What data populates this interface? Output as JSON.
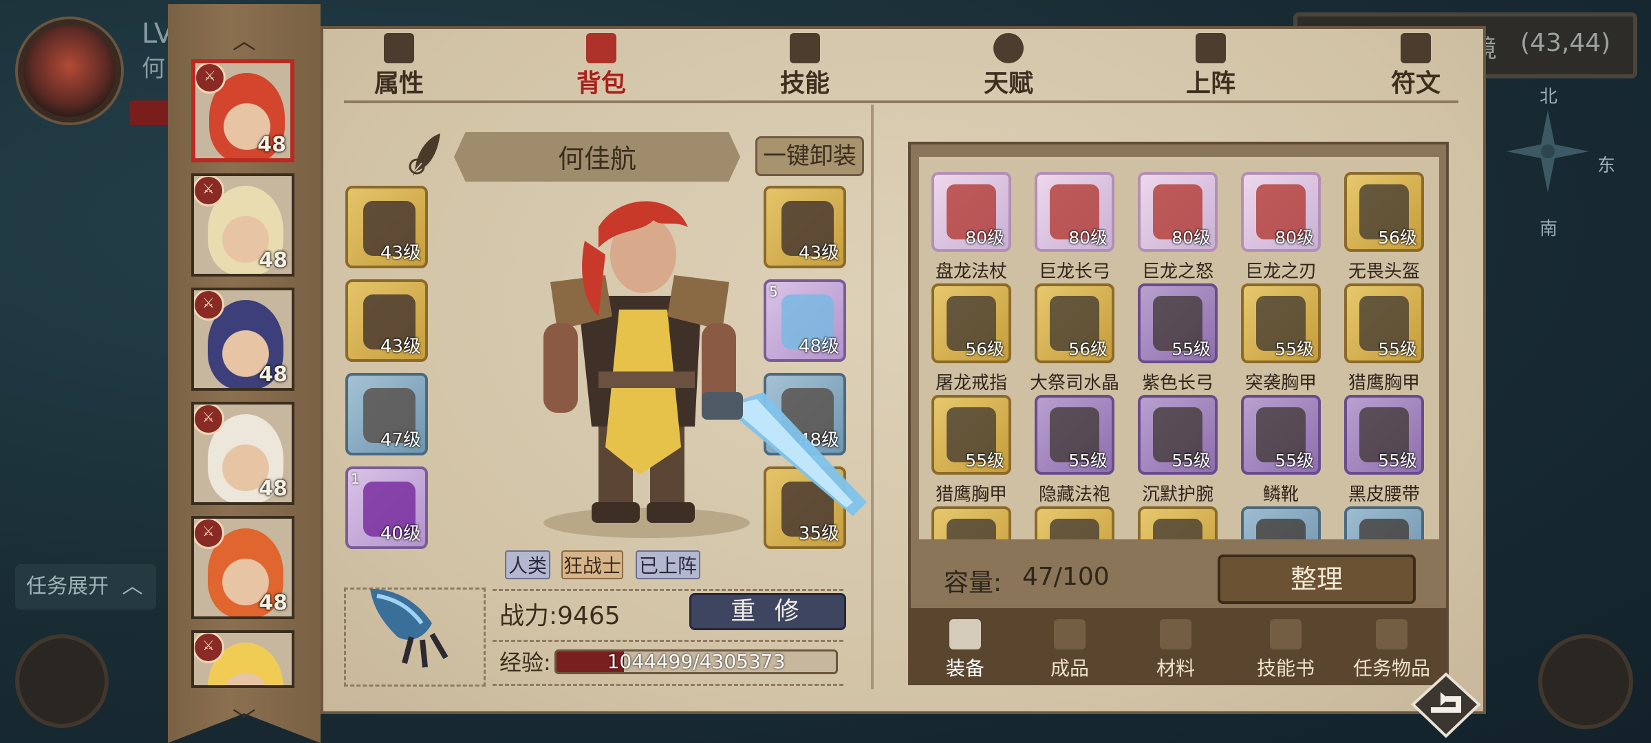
{
  "hud": {
    "level_prefix": "LV",
    "player_name_partial": "何",
    "task_toggle": "任务展开",
    "map_region_partial": "境",
    "map_coords": "(43,44)",
    "compass": {
      "north": "北",
      "south": "南",
      "east": "东"
    }
  },
  "heroes": [
    {
      "level": "48",
      "selected": true,
      "hair": "#d4452e"
    },
    {
      "level": "48",
      "selected": false,
      "hair": "#e8dcb0"
    },
    {
      "level": "48",
      "selected": false,
      "hair": "#3c3f7a"
    },
    {
      "level": "48",
      "selected": false,
      "hair": "#ede6da"
    },
    {
      "level": "48",
      "selected": false,
      "hair": "#e0652e"
    },
    {
      "level": "",
      "selected": false,
      "hair": "#f1cc55"
    }
  ],
  "tabs": [
    {
      "label": "属性",
      "icon": "flame-icon",
      "active": false
    },
    {
      "label": "背包",
      "icon": "bag-icon",
      "active": true
    },
    {
      "label": "技能",
      "icon": "book-icon",
      "active": false
    },
    {
      "label": "天赋",
      "icon": "eye-icon",
      "active": false
    },
    {
      "label": "上阵",
      "icon": "crossed-swords-icon",
      "active": false
    },
    {
      "label": "符文",
      "icon": "rune-icon",
      "active": false
    }
  ],
  "hero": {
    "name": "何佳航",
    "unequip_all": "一键卸装",
    "tags": [
      "人类",
      "狂战士",
      "已上阵"
    ],
    "power_label": "战力:",
    "power_value": "9465",
    "power_text": "战力:9465",
    "rebuild": "重 修",
    "exp_label": "经验:",
    "exp_text": "1044499/4305373",
    "exp_current": 1044499,
    "exp_max": 4305373
  },
  "equipment_left": [
    {
      "level": "43级",
      "rarity": "gold",
      "icon": "helmet-icon"
    },
    {
      "level": "43级",
      "rarity": "gold",
      "icon": "chest-armor-icon"
    },
    {
      "level": "47级",
      "rarity": "blue",
      "icon": "greaves-icon"
    },
    {
      "level": "40级",
      "rarity": "purple",
      "icon": "hood-icon",
      "count": "1"
    }
  ],
  "equipment_right": [
    {
      "level": "43级",
      "rarity": "gold",
      "icon": "shoulder-armor-icon"
    },
    {
      "level": "48级",
      "rarity": "purple",
      "icon": "crystal-sword-icon",
      "count": "5"
    },
    {
      "level": "48级",
      "rarity": "blue",
      "icon": "gauntlet-icon"
    },
    {
      "level": "35级",
      "rarity": "gold",
      "icon": "amulet-icon"
    }
  ],
  "bag": {
    "items": [
      {
        "name": "盘龙法杖",
        "level": "80级",
        "rarity": "pink",
        "icon": "staff-icon"
      },
      {
        "name": "巨龙长弓",
        "level": "80级",
        "rarity": "pink",
        "icon": "bow-icon"
      },
      {
        "name": "巨龙之怒",
        "level": "80级",
        "rarity": "pink",
        "icon": "dragon-staff-icon"
      },
      {
        "name": "巨龙之刃",
        "level": "80级",
        "rarity": "pink",
        "icon": "blade-icon"
      },
      {
        "name": "无畏头盔",
        "level": "56级",
        "rarity": "gold",
        "icon": "helmet-icon"
      },
      {
        "name": "屠龙戒指",
        "level": "56级",
        "rarity": "gold",
        "icon": "ring-icon"
      },
      {
        "name": "大祭司水晶",
        "level": "56级",
        "rarity": "gold",
        "icon": "crystal-necklace-icon"
      },
      {
        "name": "紫色长弓",
        "level": "55级",
        "rarity": "purple",
        "icon": "bow-icon"
      },
      {
        "name": "突袭胸甲",
        "level": "55级",
        "rarity": "gold",
        "icon": "chest-armor-icon"
      },
      {
        "name": "猎鹰胸甲",
        "level": "55级",
        "rarity": "gold",
        "icon": "chest-armor-icon"
      },
      {
        "name": "猎鹰胸甲",
        "level": "55级",
        "rarity": "gold",
        "icon": "chest-armor-icon"
      },
      {
        "name": "隐藏法袍",
        "level": "55级",
        "rarity": "purple",
        "icon": "robe-icon"
      },
      {
        "name": "沉默护腕",
        "level": "55级",
        "rarity": "purple",
        "icon": "bracer-icon"
      },
      {
        "name": "鳞靴",
        "level": "55级",
        "rarity": "purple",
        "icon": "boots-icon"
      },
      {
        "name": "黑皮腰带",
        "level": "55级",
        "rarity": "purple",
        "icon": "belt-icon"
      },
      {
        "name": "",
        "level": "",
        "rarity": "gold",
        "icon": "item-icon"
      },
      {
        "name": "",
        "level": "",
        "rarity": "gold",
        "icon": "item-icon"
      },
      {
        "name": "",
        "level": "",
        "rarity": "gold",
        "icon": "item-icon"
      },
      {
        "name": "",
        "level": "",
        "rarity": "blue",
        "icon": "item-icon"
      },
      {
        "name": "",
        "level": "",
        "rarity": "blue",
        "icon": "item-icon"
      }
    ],
    "capacity_label": "容量:",
    "capacity_value": "47/100",
    "sort_button": "整理",
    "tabs": [
      {
        "label": "装备",
        "icon": "hammer-icon",
        "active": true
      },
      {
        "label": "成品",
        "icon": "sack-icon",
        "active": false
      },
      {
        "label": "材料",
        "icon": "ore-icon",
        "active": false
      },
      {
        "label": "技能书",
        "icon": "scroll-icon",
        "active": false
      },
      {
        "label": "任务物品",
        "icon": "quest-scroll-icon",
        "active": false
      }
    ]
  },
  "colors": {
    "panel_bg": "#d7c9ae",
    "active_tab": "#a8211b",
    "rarity_gold": "#d9b653",
    "rarity_blue": "#8fb0c6",
    "rarity_purple": "#c6a9db",
    "rarity_pink": "#e6c6e0",
    "exp_fill": "#7a1f1f",
    "rebuild_button": "#3e4560"
  }
}
